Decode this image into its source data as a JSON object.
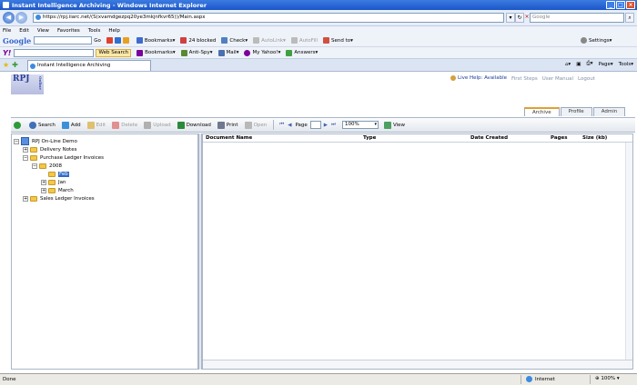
{
  "window": {
    "title": "Instant Intelligence Archiving - Windows Internet Explorer"
  },
  "address": {
    "url": "https://rpj.iiarc.net/(S(xvamdgezpq20ye3mkjnfkvr65))/Main.aspx",
    "search_placeholder": "Google"
  },
  "menu": [
    "File",
    "Edit",
    "View",
    "Favorites",
    "Tools",
    "Help"
  ],
  "google_toolbar": {
    "logo": "Google",
    "go": "Go",
    "bookmarks": "Bookmarks",
    "blocked": "24 blocked",
    "check": "Check",
    "autolink": "AutoLink",
    "autofill": "AutoFill",
    "send_to": "Send to",
    "settings": "Settings"
  },
  "yahoo_toolbar": {
    "logo": "Y!",
    "web_search": "Web Search",
    "bookmarks": "Bookmarks",
    "anti_spy": "Anti-Spy",
    "mail": "Mail",
    "my_yahoo": "My Yahoo!",
    "answers": "Answers"
  },
  "tabbar": {
    "tab_title": "Instant Intelligence Archiving",
    "page": "Page",
    "tools": "Tools"
  },
  "app": {
    "logo": "RPJ",
    "logo_sub": "Online",
    "live_help": "Live Help: Available",
    "top_links": [
      "First Steps",
      "User Manual",
      "Logout"
    ],
    "tabs": [
      {
        "label": "Archive",
        "active": true
      },
      {
        "label": "Profile",
        "active": false
      },
      {
        "label": "Admin",
        "active": false
      }
    ],
    "toolbar": {
      "search": "Search",
      "add": "Add",
      "edit": "Edit",
      "delete": "Delete",
      "upload": "Upload",
      "download": "Download",
      "print": "Print",
      "open": "Open",
      "page_label": "Page",
      "zoom": "100%",
      "view": "View"
    },
    "tree": {
      "root": "RPJ On-Line Demo",
      "nodes": [
        {
          "label": "Delivery Notes"
        },
        {
          "label": "Purchase Ledger Invoices"
        },
        {
          "label": "2008"
        },
        {
          "label": "Feb"
        },
        {
          "label": "Jan"
        },
        {
          "label": "March"
        },
        {
          "label": "Sales Ledger Invoices"
        }
      ]
    },
    "grid": {
      "columns": [
        "Document Name",
        "Type",
        "Date Created",
        "Pages",
        "Size (kb)"
      ]
    }
  },
  "status": {
    "left": "Done",
    "zone": "Internet",
    "zoom": "100%"
  },
  "colors": {
    "titlebar": "#1a56c9",
    "selection": "#316ac5",
    "tab_accent": "#e0a030"
  }
}
